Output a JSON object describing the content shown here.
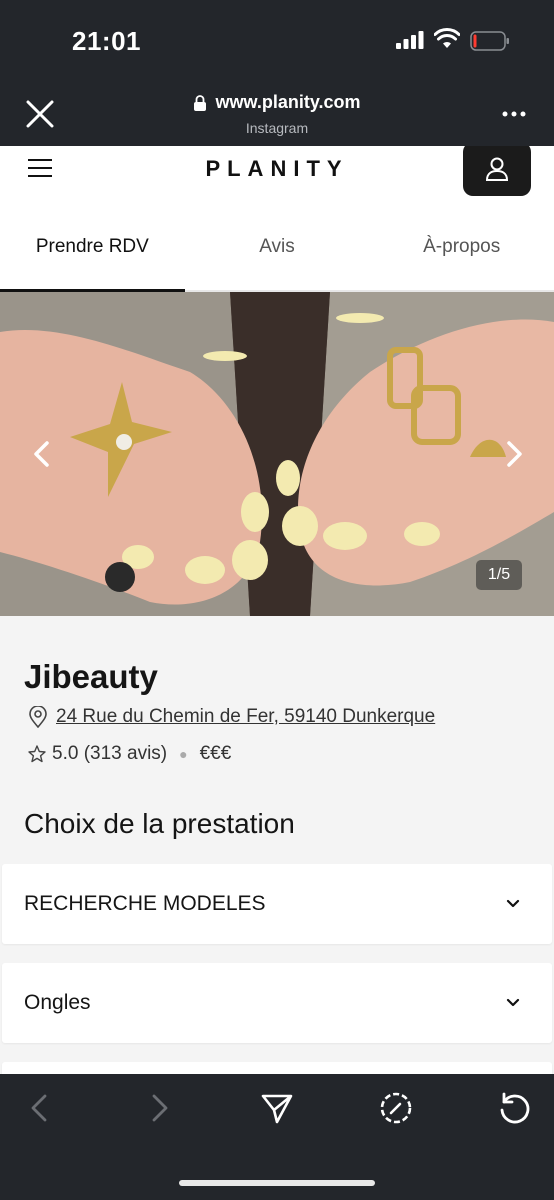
{
  "status": {
    "time": "21:01",
    "icons": [
      "signal-icon",
      "wifi-icon",
      "battery-icon"
    ]
  },
  "browser": {
    "url": "www.planity.com",
    "source": "Instagram",
    "icons": [
      "close-icon",
      "lock-icon",
      "more-icon"
    ]
  },
  "site": {
    "logo": "PLANITY",
    "icons": [
      "menu-icon",
      "user-icon"
    ]
  },
  "tabs": [
    {
      "label": "Prendre RDV",
      "active": true
    },
    {
      "label": "Avis",
      "active": false
    },
    {
      "label": "À-propos",
      "active": false
    }
  ],
  "gallery": {
    "counter": "1/5",
    "icons": [
      "chevron-left-icon",
      "chevron-right-icon"
    ]
  },
  "salon": {
    "name": "Jibeauty",
    "address": "24 Rue du Chemin de Fer, 59140 Dunkerque",
    "rating": "5.0 (313 avis)",
    "price": "€€€"
  },
  "services": {
    "title": "Choix de la prestation",
    "categories": [
      {
        "label": "RECHERCHE MODELES"
      },
      {
        "label": "Ongles"
      }
    ]
  },
  "toolbar": {
    "icons": [
      "back-icon",
      "forward-icon",
      "share-icon",
      "compass-icon",
      "reload-icon"
    ]
  },
  "colors": {
    "chrome_bg": "#23262b",
    "page_bg": "#f4f4f4",
    "accent_dark": "#1b1b1b"
  }
}
